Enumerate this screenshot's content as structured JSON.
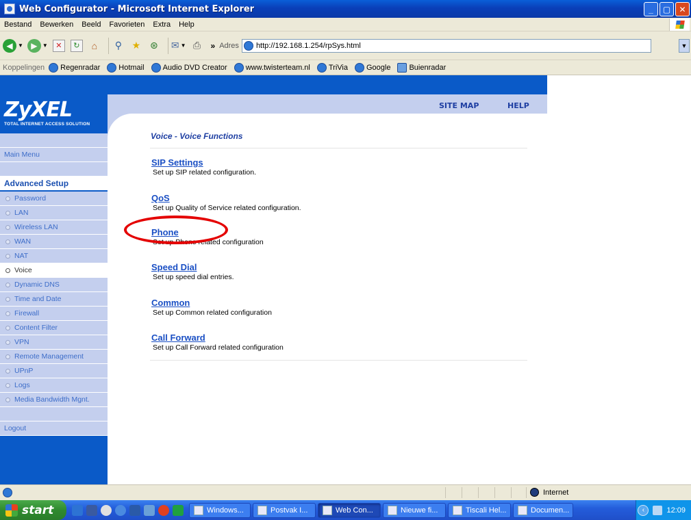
{
  "window": {
    "title": "Web Configurator - Microsoft Internet Explorer",
    "min": "_",
    "max": "▢",
    "close": "✕"
  },
  "menubar": [
    "Bestand",
    "Bewerken",
    "Beeld",
    "Favorieten",
    "Extra",
    "Help"
  ],
  "toolbar": {
    "address_label": "Adres",
    "url": "http://192.168.1.254/rpSys.html",
    "overflow": "»"
  },
  "linksbar": {
    "label": "Koppelingen",
    "links": [
      "Regenradar",
      "Hotmail",
      "Audio DVD Creator",
      "www.twisterteam.nl",
      "TriVia",
      "Google",
      "Buienradar"
    ]
  },
  "logo": {
    "brand": "ZyXEL",
    "tagline": "TOTAL INTERNET ACCESS SOLUTION"
  },
  "header": {
    "site_map": "SITE MAP",
    "help": "HELP"
  },
  "sidebar": {
    "main_menu": "Main Menu",
    "section_title": "Advanced Setup",
    "items": [
      "Password",
      "LAN",
      "Wireless LAN",
      "WAN",
      "NAT",
      "Voice",
      "Dynamic DNS",
      "Time and Date",
      "Firewall",
      "Content Filter",
      "VPN",
      "Remote Management",
      "UPnP",
      "Logs",
      "Media Bandwidth Mgnt."
    ],
    "active_item": "Voice",
    "logout": "Logout"
  },
  "main": {
    "title": "Voice - Voice Functions",
    "items": [
      {
        "label": "SIP Settings",
        "desc": "Set up SIP related configuration."
      },
      {
        "label": "QoS",
        "desc": "Set up Quality of Service related configuration."
      },
      {
        "label": "Phone",
        "desc": "Set up Phone related configuration"
      },
      {
        "label": "Speed Dial",
        "desc": "Set up speed dial entries."
      },
      {
        "label": "Common",
        "desc": "Set up Common related configuration"
      },
      {
        "label": "Call Forward",
        "desc": "Set up Call Forward related configuration"
      }
    ]
  },
  "statusbar": {
    "zone": "Internet"
  },
  "taskbar": {
    "start": "start",
    "tasks": [
      "Windows...",
      "Postvak I...",
      "Web Con...",
      "Nieuwe fi...",
      "Tiscali Hel...",
      "Documen..."
    ],
    "active_task": "Web Con...",
    "clock": "12:09"
  },
  "colors": {
    "brand_blue": "#0a5ac8",
    "menu_bg": "#c4cfee",
    "link": "#1a4fc4",
    "highlight": "#e40000"
  }
}
